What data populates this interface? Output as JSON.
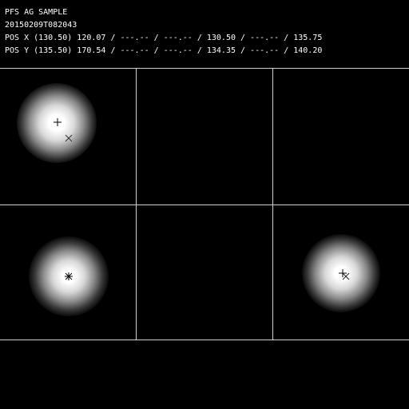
{
  "header": {
    "title": "PFS AG SAMPLE",
    "timestamp": "20150209T082043",
    "pos_x": "POS X (130.50) 120.07 / ---.-- / ---.-- / 130.50 / ---.-- / 135.75",
    "pos_y": "POS Y (135.50) 170.54 / ---.-- / ---.-- / 134.35 / ---.-- / 140.20"
  },
  "panels": [
    {
      "index": 1,
      "has_star": true,
      "markers": [
        "plus",
        "cross"
      ]
    },
    {
      "index": 2,
      "has_star": false,
      "markers": []
    },
    {
      "index": 3,
      "has_star": false,
      "markers": []
    },
    {
      "index": 4,
      "has_star": true,
      "markers": [
        "plus",
        "cross"
      ]
    },
    {
      "index": 5,
      "has_star": false,
      "markers": []
    },
    {
      "index": 6,
      "has_star": true,
      "markers": [
        "plus",
        "cross"
      ]
    }
  ],
  "colors": {
    "background": "#000000",
    "grid": "#cfcfcf",
    "text": "#ffffff",
    "marker": "#000000"
  }
}
